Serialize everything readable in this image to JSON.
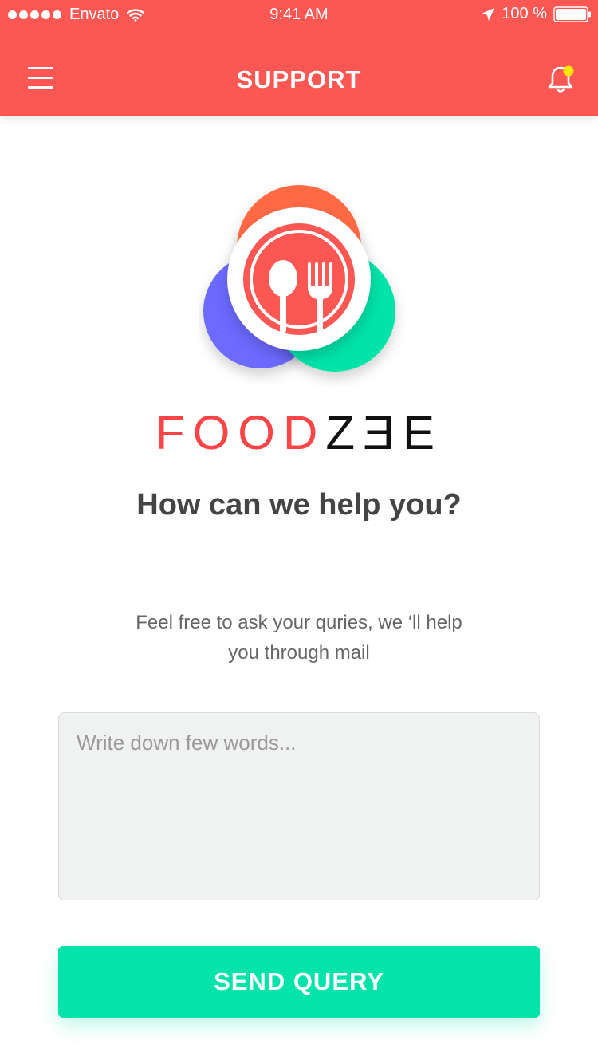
{
  "status_bar": {
    "carrier": "Envato",
    "time": "9:41 AM",
    "battery": "100 %"
  },
  "header": {
    "title": "SUPPORT",
    "menu_icon": "hamburger-menu-icon",
    "notification_icon": "bell-icon",
    "notification_dot_color": "#ffe600"
  },
  "brand": {
    "part1": "FOOD",
    "part2": "ZƎE",
    "color_primary": "#fd4447",
    "color_secondary": "#111111"
  },
  "main": {
    "headline": "How can we help you?",
    "description": "Feel free to ask your quries, we ‘ll help you through mail",
    "input": {
      "placeholder": "Write down few words...",
      "value": ""
    },
    "send_button": "SEND QUERY"
  },
  "colors": {
    "header": "#fd5754",
    "accent": "#04e3a9",
    "logo_orange": "#ff6b45",
    "logo_purple": "#6c6bff",
    "logo_green": "#04e3a9"
  }
}
